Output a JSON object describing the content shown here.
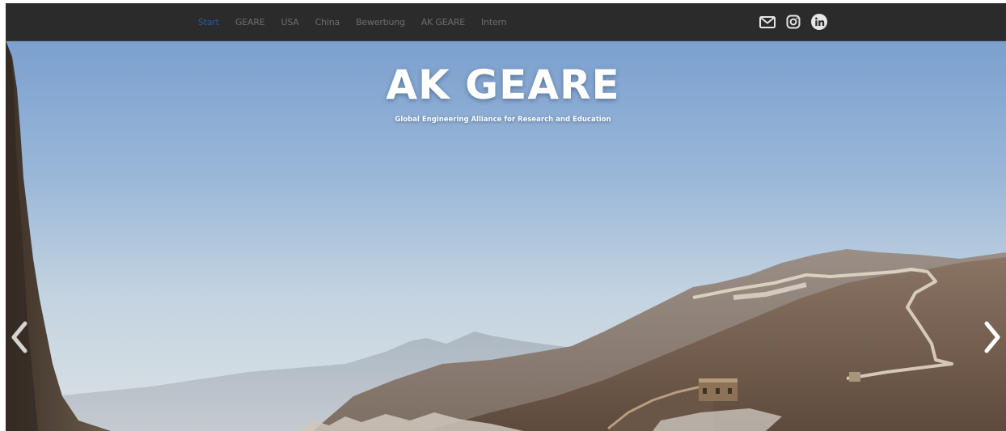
{
  "nav": {
    "items": [
      {
        "label": "Start",
        "active": true
      },
      {
        "label": "GEARE",
        "active": false
      },
      {
        "label": "USA",
        "active": false
      },
      {
        "label": "China",
        "active": false
      },
      {
        "label": "Bewerbung",
        "active": false
      },
      {
        "label": "AK GEARE",
        "active": false
      },
      {
        "label": "Intern",
        "active": false
      }
    ],
    "social": [
      {
        "icon": "mail-icon"
      },
      {
        "icon": "instagram-icon"
      },
      {
        "icon": "linkedin-icon"
      }
    ]
  },
  "hero": {
    "title": "AK GEARE",
    "subtitle": "Global Engineering Alliance for Research and Education",
    "prev_icon": "chevron-left-icon",
    "next_icon": "chevron-right-icon"
  },
  "colors": {
    "navbar_bg": "#2b2b2b",
    "nav_text": "#6e6e6e",
    "nav_active": "#2e5a9c",
    "sky_top": "#7da1cf",
    "sky_bottom": "#dde3e5"
  }
}
